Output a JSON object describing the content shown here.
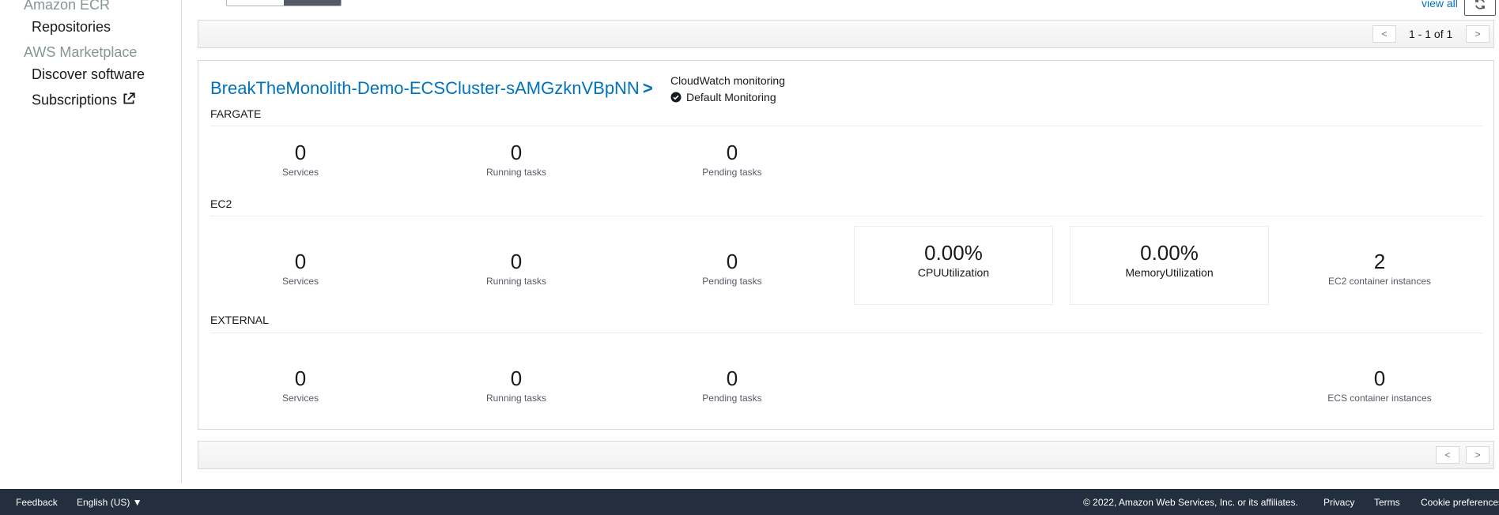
{
  "sidebar": {
    "sections": [
      {
        "title": "Amazon ECR",
        "items": [
          "Repositories"
        ]
      },
      {
        "title": "AWS Marketplace",
        "items": [
          "Discover software",
          "Subscriptions"
        ]
      }
    ]
  },
  "toolbar": {
    "view_all_label": "view all",
    "pagination_text": "1 - 1 of 1",
    "prev_label": "<",
    "next_label": ">"
  },
  "cluster": {
    "name": "BreakTheMonolith-Demo-ECSCluster-sAMGzknVBpNN",
    "chevron": ">",
    "monitoring_title": "CloudWatch monitoring",
    "monitoring_status": "Default Monitoring",
    "sections": {
      "fargate": {
        "label": "FARGATE",
        "services": {
          "value": "0",
          "label": "Services"
        },
        "running_tasks": {
          "value": "0",
          "label": "Running tasks"
        },
        "pending_tasks": {
          "value": "0",
          "label": "Pending tasks"
        }
      },
      "ec2": {
        "label": "EC2",
        "services": {
          "value": "0",
          "label": "Services"
        },
        "running_tasks": {
          "value": "0",
          "label": "Running tasks"
        },
        "pending_tasks": {
          "value": "0",
          "label": "Pending tasks"
        },
        "cpu": {
          "value": "0.00%",
          "label": "CPUUtilization"
        },
        "memory": {
          "value": "0.00%",
          "label": "MemoryUtilization"
        },
        "instances": {
          "value": "2",
          "label": "EC2 container instances"
        }
      },
      "external": {
        "label": "EXTERNAL",
        "services": {
          "value": "0",
          "label": "Services"
        },
        "running_tasks": {
          "value": "0",
          "label": "Running tasks"
        },
        "pending_tasks": {
          "value": "0",
          "label": "Pending tasks"
        },
        "instances": {
          "value": "0",
          "label": "ECS container instances"
        }
      }
    }
  },
  "footer": {
    "feedback": "Feedback",
    "language": "English (US) ▼",
    "copyright": "© 2022, Amazon Web Services, Inc. or its affiliates.",
    "privacy": "Privacy",
    "terms": "Terms",
    "cookie": "Cookie preferences"
  },
  "colors": {
    "link": "#0073bb",
    "footer_bg": "#232f3e",
    "border": "#d5dbdb"
  }
}
